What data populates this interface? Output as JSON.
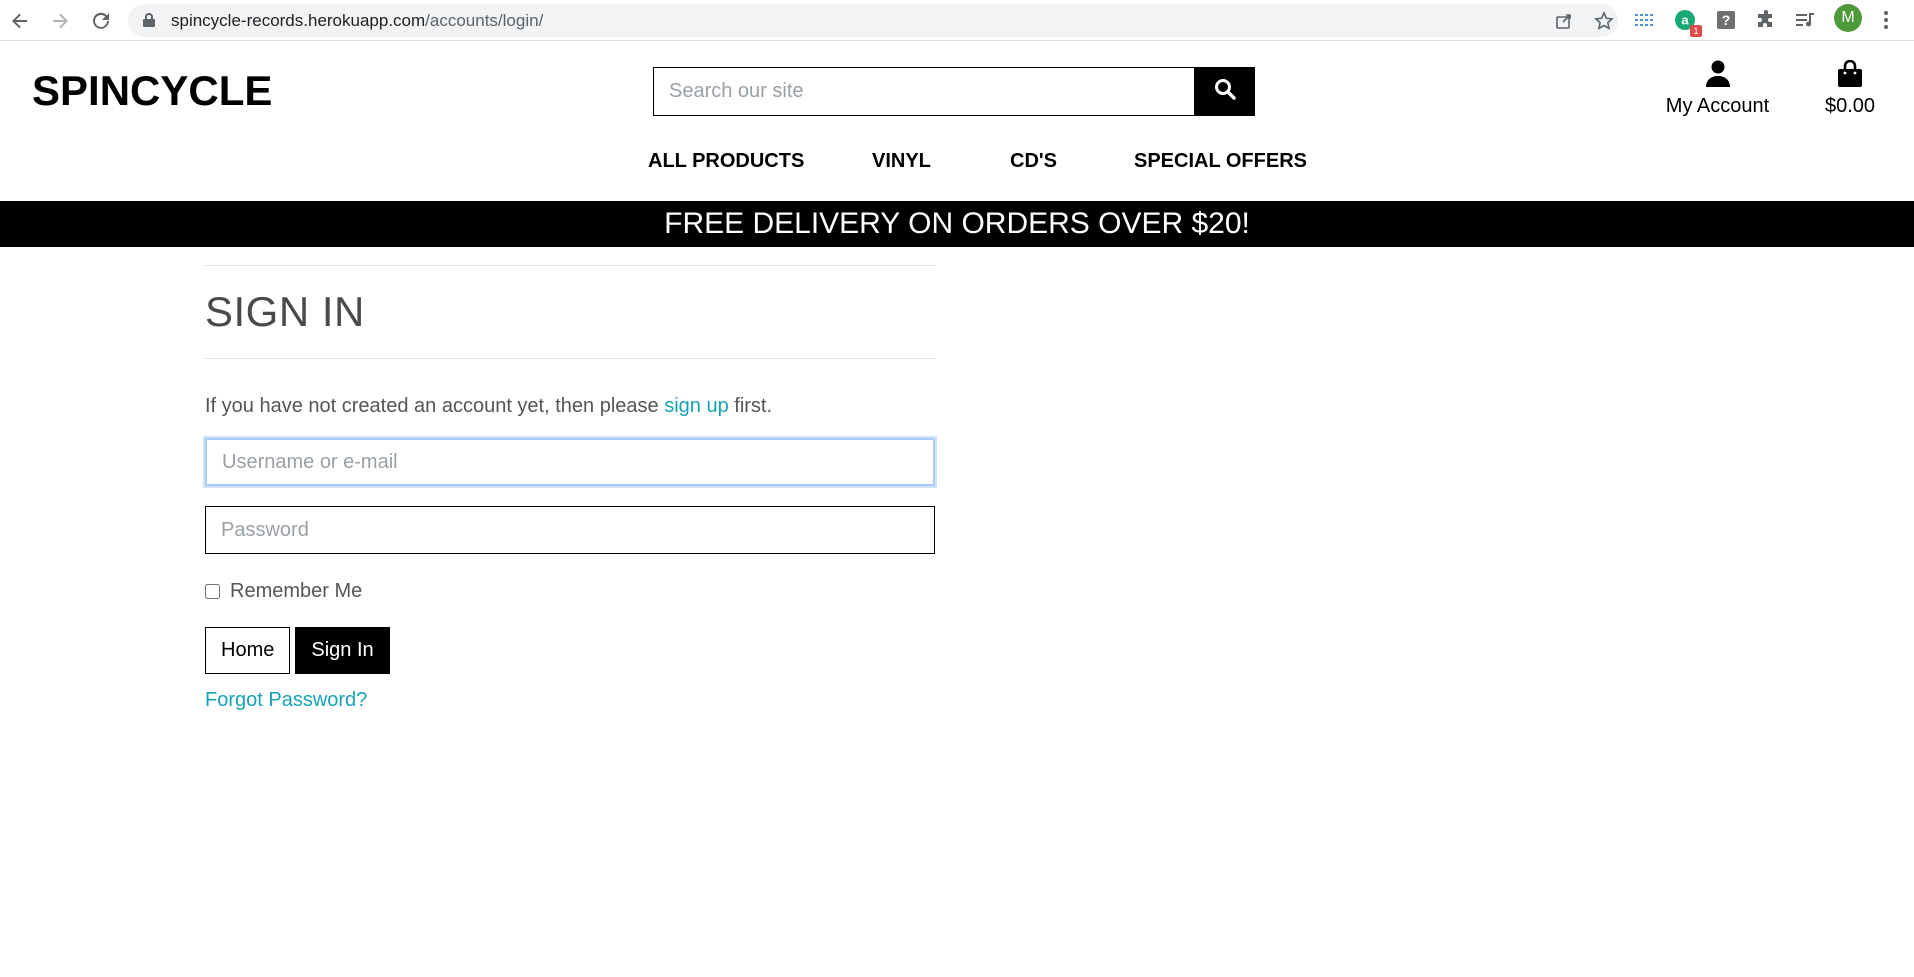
{
  "browser": {
    "url_host": "spincycle-records.herokuapp.com",
    "url_path": "/accounts/login/",
    "profile_initial": "M",
    "extension_badge": "1",
    "icons": [
      "back-icon",
      "forward-icon",
      "reload-icon",
      "lock-icon",
      "share-icon",
      "star-icon",
      "apps-icon",
      "extension-icon",
      "help-icon",
      "puzzle-icon",
      "media-icon",
      "menu-icon"
    ]
  },
  "site": {
    "logo": "SPINCYCLE",
    "search_placeholder": "Search our site",
    "account_label": "My Account",
    "bag_total": "$0.00"
  },
  "nav": {
    "all_products": "ALL PRODUCTS",
    "vinyl": "VINYL",
    "cds": "CD'S",
    "special_offers": "SPECIAL OFFERS"
  },
  "banner": "FREE DELIVERY ON ORDERS OVER $20!",
  "signin": {
    "title": "SIGN IN",
    "intro_before": "If you have not created an account yet, then please ",
    "intro_link": "sign up",
    "intro_after": " first.",
    "username_placeholder": "Username or e-mail",
    "password_placeholder": "Password",
    "remember_label": "Remember Me",
    "home_button": "Home",
    "signin_button": "Sign In",
    "forgot_link": "Forgot Password?"
  },
  "colors": {
    "link": "#17a2b8",
    "banner_bg": "#000000",
    "focus_border": "#a9cbf5"
  }
}
